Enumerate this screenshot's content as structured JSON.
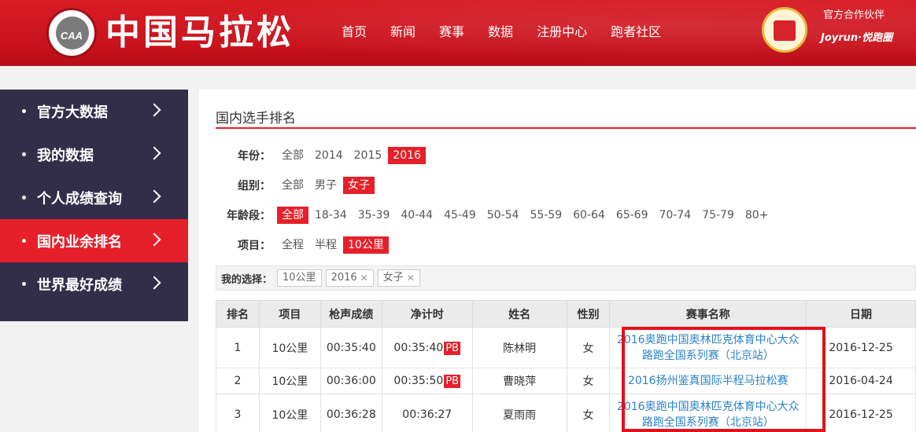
{
  "header": {
    "logo_abbr": "CAA",
    "site_title": "中国马拉松",
    "nav": [
      "首页",
      "新闻",
      "赛事",
      "数据",
      "注册中心",
      "跑者社区"
    ],
    "partner_label": "官方合作伙伴",
    "partner_name": "Joyrun·悦跑圈"
  },
  "sidebar": {
    "items": [
      {
        "label": "官方大数据",
        "active": false
      },
      {
        "label": "我的数据",
        "active": false
      },
      {
        "label": "个人成绩查询",
        "active": false
      },
      {
        "label": "国内业余排名",
        "active": true
      },
      {
        "label": "世界最好成绩",
        "active": false
      }
    ]
  },
  "main": {
    "title": "国内选手排名",
    "filters": {
      "year": {
        "label": "年份：",
        "options": [
          "全部",
          "2014",
          "2015",
          "2016"
        ],
        "selected": "2016"
      },
      "group": {
        "label": "组别：",
        "options": [
          "全部",
          "男子",
          "女子"
        ],
        "selected": "女子"
      },
      "age": {
        "label": "年龄段：",
        "options": [
          "全部",
          "18-34",
          "35-39",
          "40-44",
          "45-49",
          "50-54",
          "55-59",
          "60-64",
          "65-69",
          "70-74",
          "75-79",
          "80+"
        ],
        "selected": "全部"
      },
      "event": {
        "label": "项目：",
        "options": [
          "全程",
          "半程",
          "10公里"
        ],
        "selected": "10公里"
      }
    },
    "my_choice": {
      "label": "我的选择：",
      "chips": [
        {
          "text": "10公里",
          "removable": false
        },
        {
          "text": "2016",
          "removable": true
        },
        {
          "text": "女子",
          "removable": true
        }
      ]
    },
    "table": {
      "headers": [
        "排名",
        "项目",
        "枪声成绩",
        "净计时",
        "姓名",
        "性别",
        "赛事名称",
        "日期"
      ],
      "pb_label": "PB",
      "rows": [
        {
          "rank": "1",
          "event": "10公里",
          "gun": "00:35:40",
          "net": "00:35:40",
          "pb": true,
          "name": "陈林明",
          "gender": "女",
          "race": "2016奥跑中国奥林匹克体育中心大众路跑全国系列赛（北京站）",
          "date": "2016-12-25"
        },
        {
          "rank": "2",
          "event": "10公里",
          "gun": "00:36:00",
          "net": "00:35:50",
          "pb": true,
          "name": "曹晓萍",
          "gender": "女",
          "race": "2016扬州鉴真国际半程马拉松赛",
          "date": "2016-04-24"
        },
        {
          "rank": "3",
          "event": "10公里",
          "gun": "00:36:28",
          "net": "00:36:27",
          "pb": false,
          "name": "夏雨雨",
          "gender": "女",
          "race": "2016奥跑中国奥林匹克体育中心大众路跑全国系列赛（北京站）",
          "date": "2016-12-25"
        }
      ]
    }
  }
}
